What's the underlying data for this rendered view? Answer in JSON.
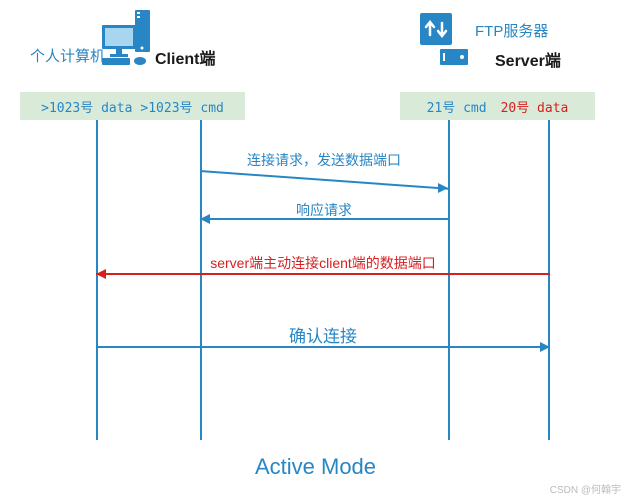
{
  "colors": {
    "primary": "#2886c5",
    "accent": "#d62020",
    "port_bg": "#d9ead9"
  },
  "client": {
    "label": "个人计算机",
    "role": "Client端",
    "data_port": ">1023号 data",
    "cmd_port": ">1023号 cmd"
  },
  "server": {
    "label": "FTP服务器",
    "role": "Server端",
    "cmd_port": "21号 cmd",
    "data_port": "20号 data"
  },
  "messages": {
    "m1": "连接请求，发送数据端口",
    "m2": "响应请求",
    "m3": "server端主动连接client端的数据端口",
    "m4": "确认连接"
  },
  "title": "Active Mode",
  "watermark": "CSDN @何翰宇",
  "chart_data": {
    "type": "sequence-diagram",
    "actors": [
      {
        "name": "个人计算机 / Client端",
        "ports": [
          ">1023号 data",
          ">1023号 cmd"
        ]
      },
      {
        "name": "FTP服务器 / Server端",
        "ports": [
          "21号 cmd",
          "20号 data"
        ]
      }
    ],
    "lifelines": [
      "client-data",
      "client-cmd",
      "server-cmd",
      "server-data"
    ],
    "messages": [
      {
        "from": "client-cmd",
        "to": "server-cmd",
        "text": "连接请求，发送数据端口",
        "color": "blue"
      },
      {
        "from": "server-cmd",
        "to": "client-cmd",
        "text": "响应请求",
        "color": "blue"
      },
      {
        "from": "server-data",
        "to": "client-data",
        "text": "server端主动连接client端的数据端口",
        "color": "red"
      },
      {
        "from": "client-data",
        "to": "server-data",
        "text": "确认连接",
        "color": "blue"
      }
    ],
    "title": "Active Mode"
  }
}
